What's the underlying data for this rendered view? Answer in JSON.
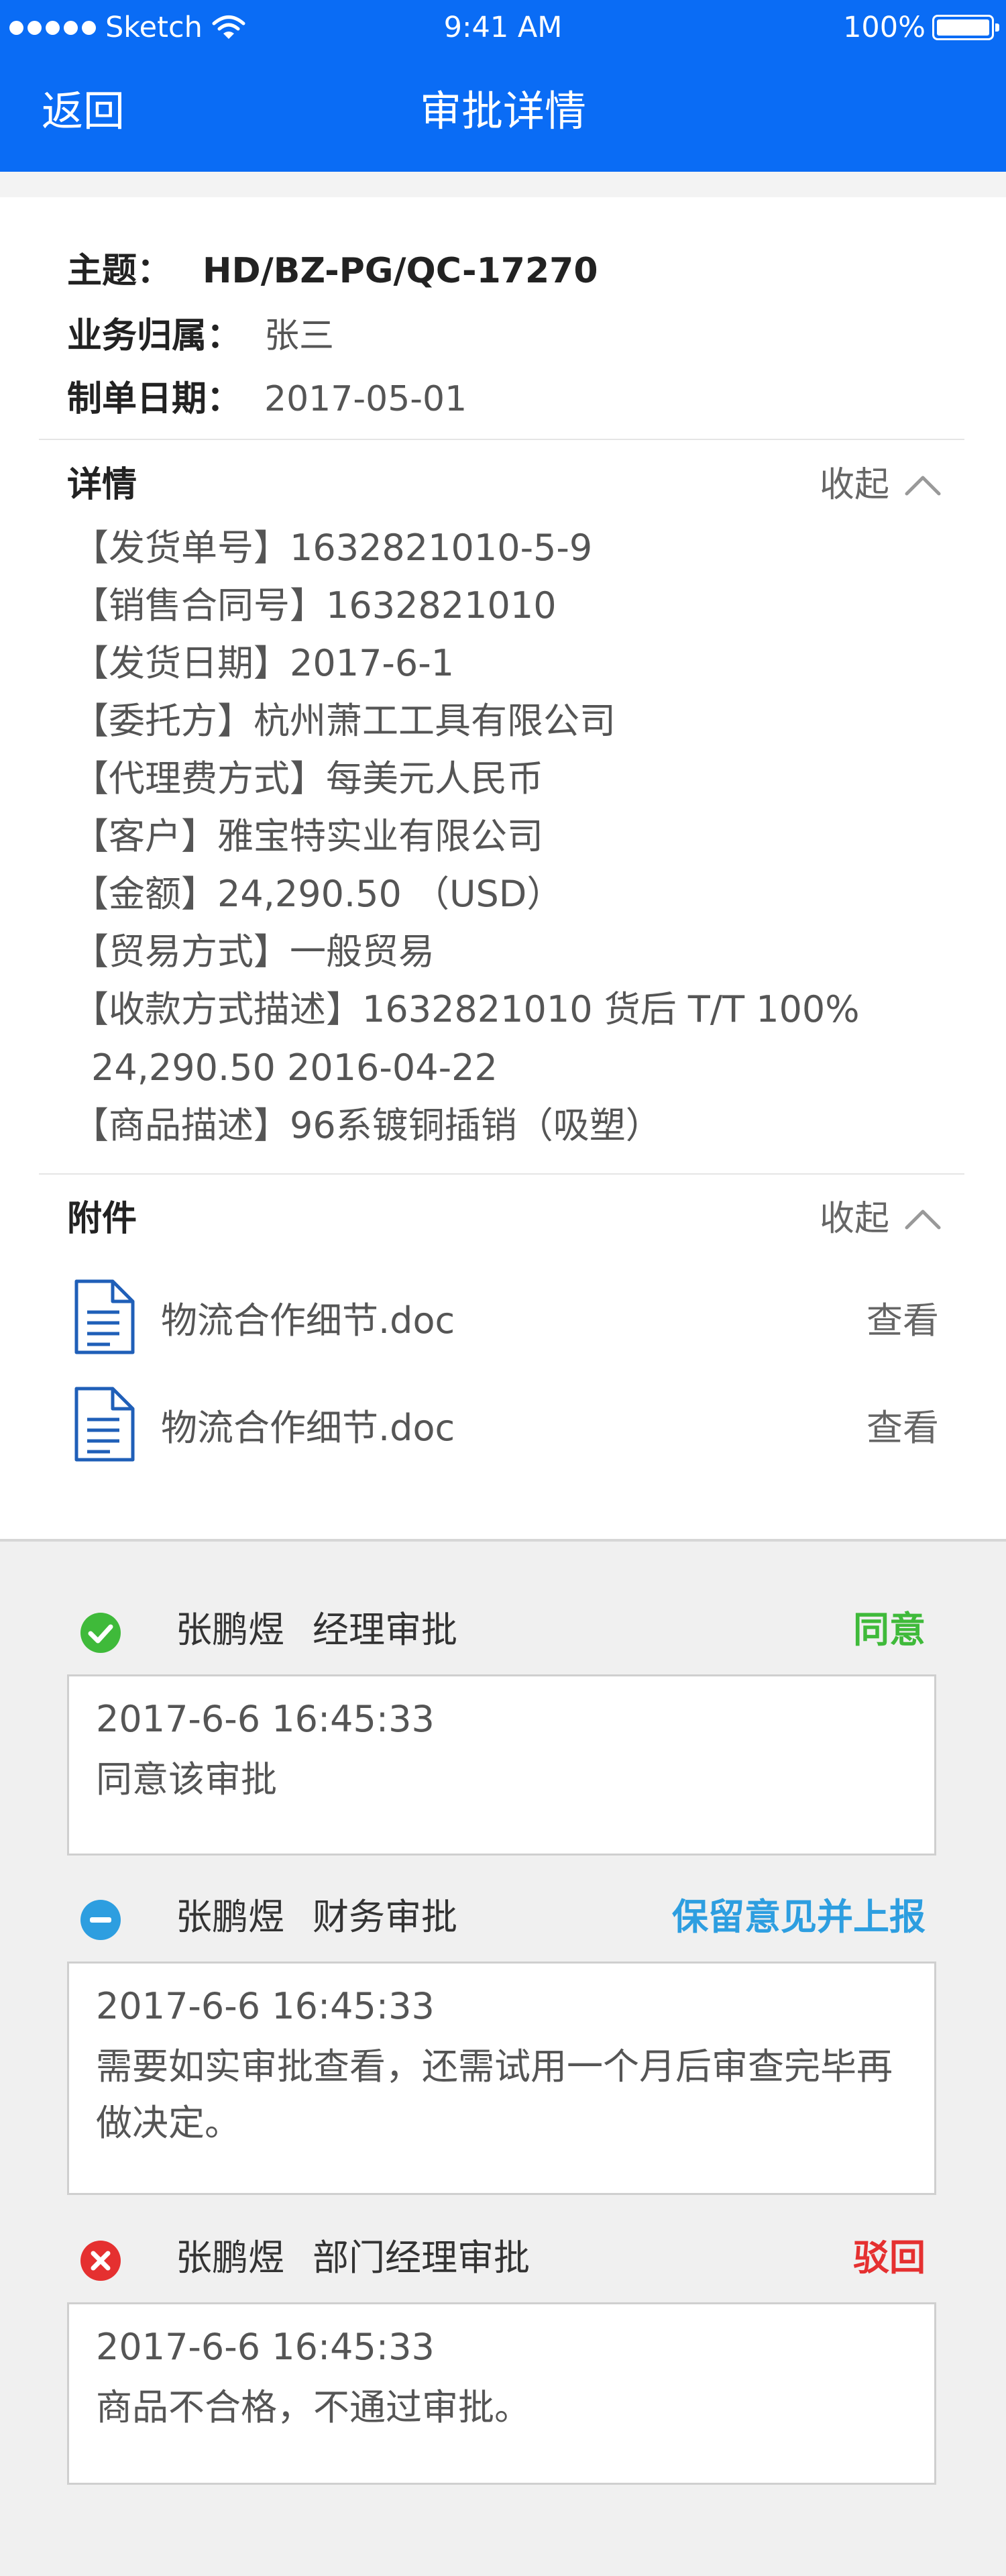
{
  "status_bar": {
    "carrier": "Sketch",
    "time": "9:41 AM",
    "battery_text": "100%",
    "battery_level": 1.0
  },
  "nav": {
    "back_label": "返回",
    "title": "审批详情",
    "bg_color": "#0a6cf5"
  },
  "info": {
    "subject_label": "主题：",
    "subject_value": "HD/BZ-PG/QC-17270",
    "owner_label": "业务归属：",
    "owner_value": "张三",
    "date_label": "制单日期：",
    "date_value": "2017-05-01"
  },
  "details": {
    "title": "详情",
    "collapse_label": "收起",
    "items": [
      "【发货单号】1632821010-5-9",
      "【销售合同号】1632821010",
      "【发货日期】2017-6-1",
      "【委托方】杭州萧工工具有限公司",
      "【代理费方式】每美元人民币",
      "【客户】雅宝特实业有限公司",
      "【金额】24,290.50 （USD）",
      "【贸易方式】一般贸易",
      "【收款方式描述】1632821010 货后 T/T 100%"
    ],
    "items_cont": "24,290.50 2016-04-22",
    "last_item": "【商品描述】96系镀铜插销（吸塑）"
  },
  "attachments": {
    "title": "附件",
    "collapse_label": "收起",
    "files": [
      {
        "name": "物流合作细节.doc",
        "view_label": "查看"
      },
      {
        "name": "物流合作细节.doc",
        "view_label": "查看"
      }
    ]
  },
  "approvals": [
    {
      "status_icon": "check-circle-icon",
      "name": "张鹏煜",
      "role": "经理审批",
      "result": "同意",
      "result_color": "#3fba3a",
      "time": "2017-6-6 16:45:33",
      "comment": "同意该审批"
    },
    {
      "status_icon": "minus-circle-icon",
      "name": "张鹏煜",
      "role": "财务审批",
      "result": "保留意见并上报",
      "result_color": "#2d9ee0",
      "time": "2017-6-6 16:45:33",
      "comment": "需要如实审批查看，还需试用一个月后审查完毕再做决定。"
    },
    {
      "status_icon": "x-circle-icon",
      "name": "张鹏煜",
      "role": "部门经理审批",
      "result": "驳回",
      "result_color": "#e53030",
      "time": "2017-6-6 16:45:33",
      "comment": "商品不合格，不通过审批。"
    }
  ]
}
